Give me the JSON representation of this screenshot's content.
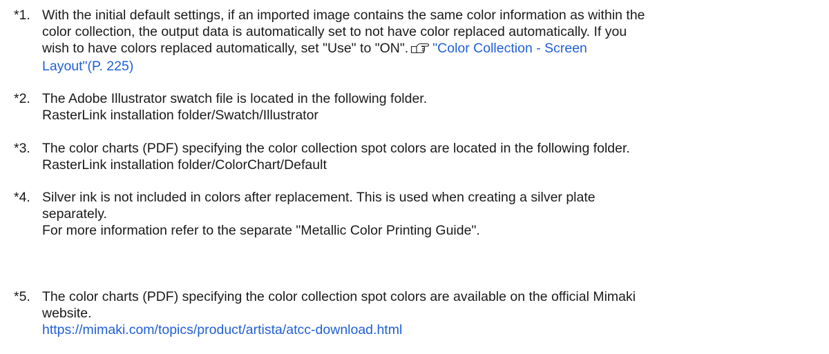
{
  "notes": [
    {
      "marker": "*1.",
      "text_lines": [
        "With the initial default settings, if an imported image contains the same color information as within the",
        "color collection, the output data is automatically set to not have color replaced automatically. If you",
        "wish to have colors replaced automatically, set \"Use\" to \"ON\"."
      ],
      "ref_icon": "pointing-hand-reference-icon",
      "ref_link_line1": "\"Color Collection - Screen",
      "ref_link_line2": "Layout\"(P. 225)"
    },
    {
      "marker": "*2.",
      "text_lines": [
        "The Adobe Illustrator swatch file is located in the following folder.",
        "RasterLink installation folder/Swatch/Illustrator"
      ]
    },
    {
      "marker": "*3.",
      "text_lines": [
        "The color charts (PDF) specifying the color collection spot colors are located in the following folder.",
        "RasterLink installation folder/ColorChart/Default"
      ]
    },
    {
      "marker": "*4.",
      "text_lines": [
        "Silver ink is not included in colors after replacement. This is used when creating a silver plate",
        "separately."
      ],
      "extra_line": "For more information refer to the separate \"Metallic Color Printing Guide\"."
    },
    {
      "marker": "*5.",
      "text_lines": [
        "The color charts (PDF) specifying the color collection spot colors are available on the official Mimaki",
        "website."
      ],
      "url": "https://mimaki.com/topics/product/artista/atcc-download.html"
    }
  ],
  "colors": {
    "text": "#1a1a1a",
    "link": "#1f5fd6"
  }
}
